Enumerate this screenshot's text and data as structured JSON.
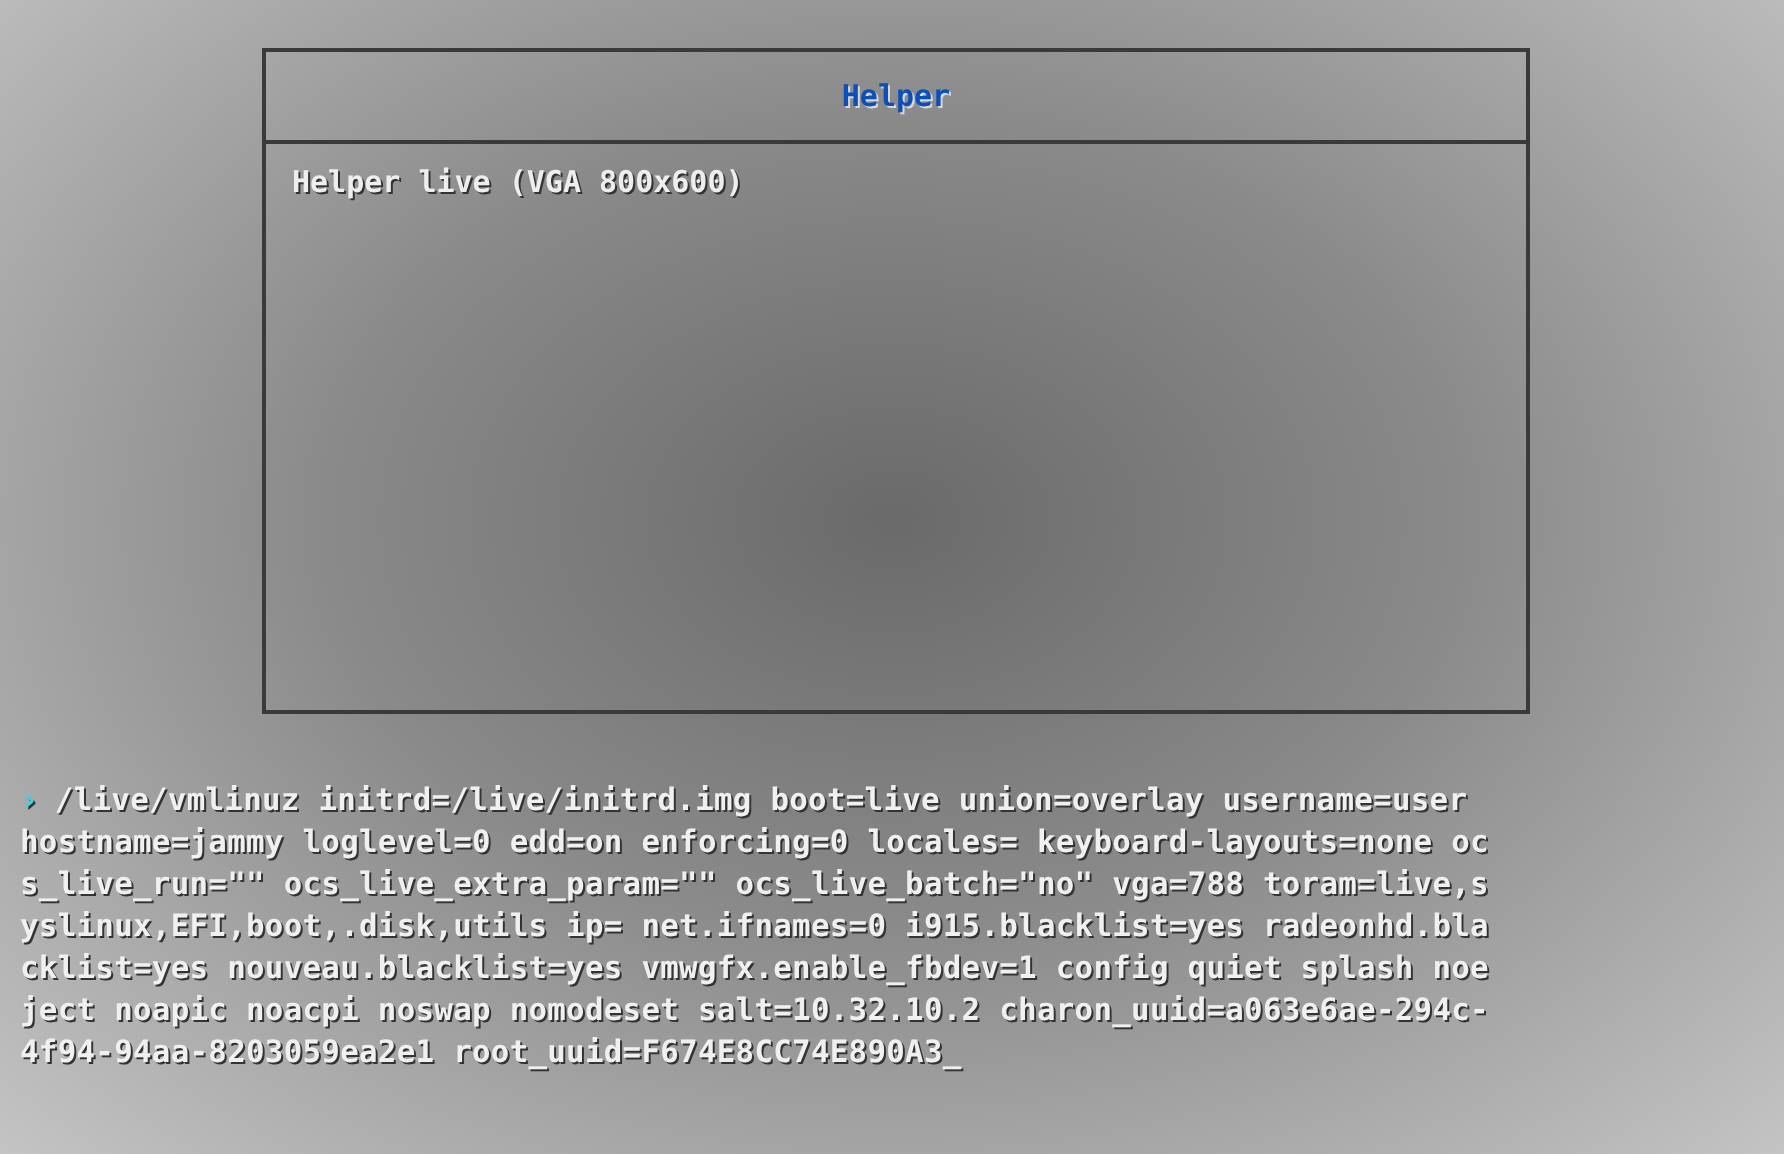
{
  "menu": {
    "title": "Helper",
    "items": [
      {
        "label": "Helper live (VGA 800x600)"
      }
    ]
  },
  "command_line": {
    "prompt": "›",
    "lines": [
      "/live/vmlinuz initrd=/live/initrd.img boot=live union=overlay username=user",
      "hostname=jammy loglevel=0 edd=on enforcing=0 locales= keyboard-layouts=none oc",
      "s_live_run=\"\" ocs_live_extra_param=\"\" ocs_live_batch=\"no\" vga=788 toram=live,s",
      "yslinux,EFI,boot,.disk,utils ip= net.ifnames=0 i915.blacklist=yes radeonhd.bla",
      "cklist=yes nouveau.blacklist=yes vmwgfx.enable_fbdev=1 config quiet splash noe",
      "ject noapic noacpi noswap nomodeset salt=10.32.10.2 charon_uuid=a063e6ae-294c-",
      "4f94-94aa-8203059ea2e1 root_uuid=F674E8CC74E890A3_"
    ]
  }
}
